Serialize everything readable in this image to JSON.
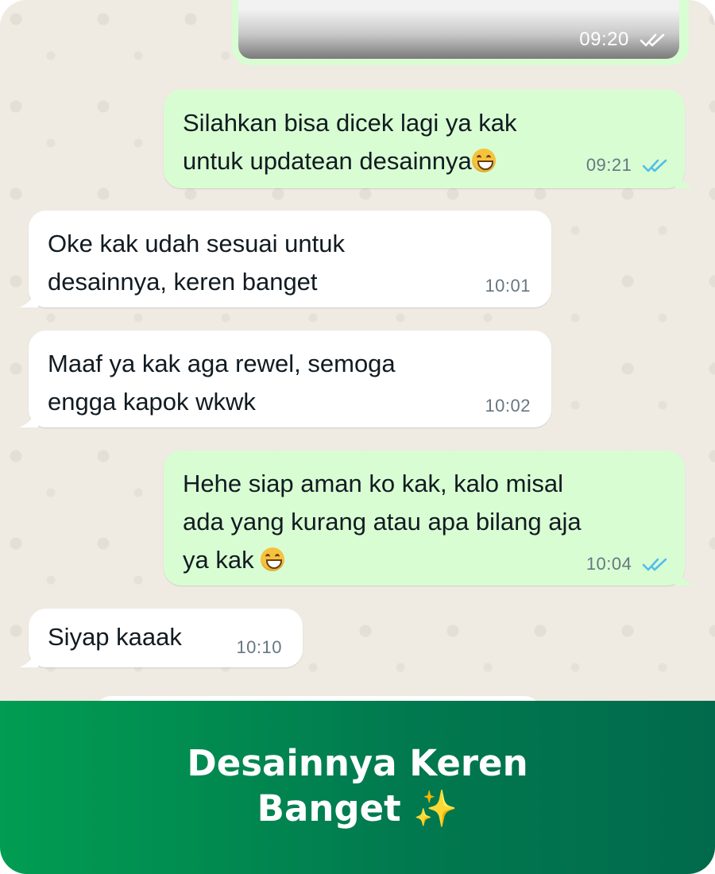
{
  "chat": {
    "top_image_message": {
      "time": "09:20"
    },
    "messages": [
      {
        "direction": "out",
        "text": "Silahkan bisa dicek lagi ya kak\nuntuk updatean desainnya",
        "emoji": "grinning-face",
        "time": "09:21",
        "status": "read"
      },
      {
        "direction": "in",
        "text": "Oke kak udah sesuai untuk\ndesainnya, keren banget",
        "time": "10:01"
      },
      {
        "direction": "in",
        "text": "Maaf ya kak aga rewel, semoga\nengga kapok wkwk",
        "time": "10:02"
      },
      {
        "direction": "out",
        "text": "Hehe siap aman ko kak, kalo misal\nada yang kurang atau apa bilang aja\nya kak",
        "emoji": "grinning-face",
        "time": "10:04",
        "status": "read"
      },
      {
        "direction": "in",
        "text": "Siyap kaaak",
        "time": "10:10"
      }
    ]
  },
  "footer": {
    "title_line1": "Desainnya Keren",
    "title_line2": "Banget ✨"
  },
  "colors": {
    "chat_background": "#efeae2",
    "outgoing_bubble": "#d9fdd3",
    "incoming_bubble": "#ffffff",
    "read_ticks": "#53bdeb",
    "footer_gradient_start": "#019d52",
    "footer_gradient_end": "#016a4c"
  },
  "icons": {
    "read_status": "double-check-icon",
    "emoji": "grinning-face-icon",
    "sparkles": "sparkles-icon"
  }
}
